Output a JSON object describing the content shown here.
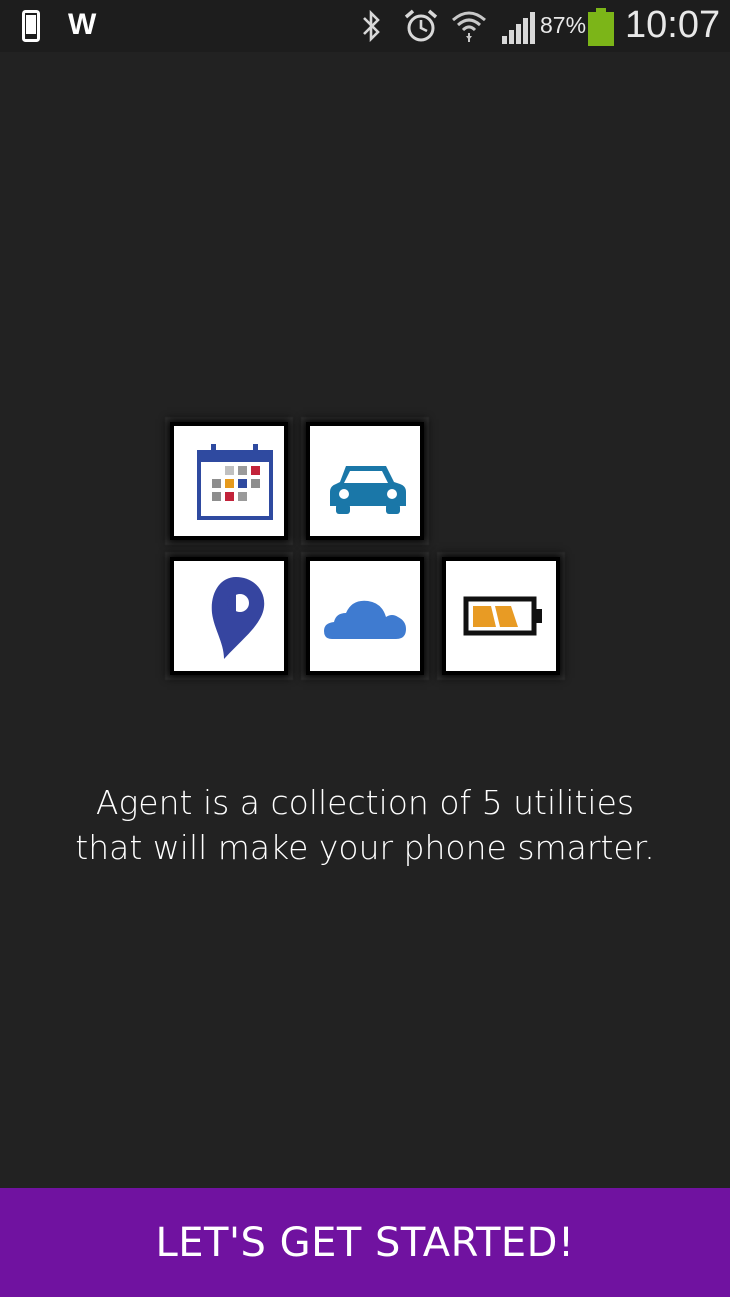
{
  "status_bar": {
    "notification_w": "W",
    "battery_percent": "87%",
    "time": "10:07",
    "icons": [
      "phone-icon",
      "bluetooth-icon",
      "alarm-icon",
      "wifi-icon",
      "signal-icon",
      "battery-icon"
    ],
    "battery_color": "#7cb518"
  },
  "utilities": [
    {
      "icon": "calendar-icon"
    },
    {
      "icon": "car-icon"
    },
    {
      "icon": "location-pin-icon"
    },
    {
      "icon": "cloud-icon"
    },
    {
      "icon": "battery-charging-icon"
    }
  ],
  "tagline": {
    "line1": "Agent is a collection of 5 utilities",
    "line2": "that will make your phone smarter."
  },
  "cta": {
    "label": "LET'S GET STARTED!",
    "color": "#7012a0"
  }
}
